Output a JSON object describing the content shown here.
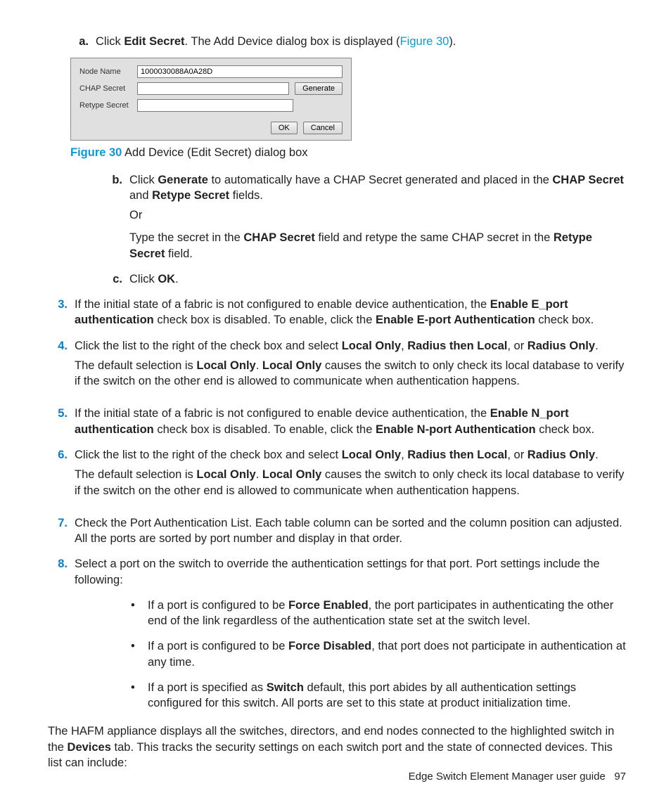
{
  "step_a": {
    "marker": "a.",
    "pre": "Click ",
    "bold": "Edit Secret",
    "post": ". The Add Device dialog box is displayed (",
    "link": "Figure 30",
    "tail": ")."
  },
  "dialog": {
    "label_node": "Node Name",
    "value_node": "1000030088A0A28D",
    "label_chap": "CHAP Secret",
    "label_retype": "Retype Secret",
    "btn_generate": "Generate",
    "btn_ok": "OK",
    "btn_cancel": "Cancel"
  },
  "figcap": {
    "label": "Figure 30",
    "text": " Add Device (Edit Secret) dialog box"
  },
  "step_b": {
    "marker": "b.",
    "t1": "Click ",
    "b1": "Generate",
    "t2": " to automatically have a CHAP Secret generated and placed in the ",
    "b2": "CHAP Secret",
    "t3": " and ",
    "b3": "Retype Secret",
    "t4": " fields.",
    "or": "Or",
    "t5": "Type the secret in the ",
    "b4": "CHAP Secret",
    "t6": " field and retype the same CHAP secret in the ",
    "b5": "Retype Secret",
    "t7": " field."
  },
  "step_c": {
    "marker": "c.",
    "t1": "Click ",
    "b1": "OK",
    "t2": "."
  },
  "step3": {
    "marker": "3.",
    "t1": "If the initial state of a fabric is not configured to enable device authentication, the ",
    "b1": "Enable E_port authentication",
    "t2": " check box is disabled. To enable, click the ",
    "b2": "Enable E-port Authentication",
    "t3": " check box."
  },
  "step4": {
    "marker": "4.",
    "t1": "Click the list to the right of the check box and select ",
    "b1": "Local Only",
    "t2": ", ",
    "b2": "Radius then Local",
    "t3": ", or ",
    "b3": "Radius Only",
    "t4": ".",
    "p_t1": "The default selection is ",
    "p_b1": "Local Only",
    "p_t2": ". ",
    "p_b2": "Local Only",
    "p_t3": " causes the switch to only check its local database to verify if the switch on the other end is allowed to communicate when authentication happens."
  },
  "step5": {
    "marker": "5.",
    "t1": "If the initial state of a fabric is not configured to enable device authentication, the ",
    "b1": "Enable N_port authentication",
    "t2": " check box is disabled. To enable, click the ",
    "b2": "Enable N-port Authentication",
    "t3": " check box."
  },
  "step6": {
    "marker": "6.",
    "t1": "Click the list to the right of the check box and select ",
    "b1": "Local Only",
    "t2": ", ",
    "b2": "Radius then Local",
    "t3": ", or ",
    "b3": "Radius Only",
    "t4": ".",
    "p_t1": "The default selection is ",
    "p_b1": "Local Only",
    "p_t2": ". ",
    "p_b2": "Local Only",
    "p_t3": " causes the switch to only check its local database to verify if the switch on the other end is allowed to communicate when authentication happens."
  },
  "step7": {
    "marker": "7.",
    "text": "Check the Port Authentication List. Each table column can be sorted and the column position can adjusted. All the ports are sorted by port number and display in that order."
  },
  "step8": {
    "marker": "8.",
    "text": "Select a port on the switch to override the authentication settings for that port. Port settings include the following:"
  },
  "bullets": {
    "dot": "•",
    "i1": {
      "t1": "If a port is configured to be ",
      "b1": "Force Enabled",
      "t2": ", the port participates in authenticating the other end of the link regardless of the authentication state set at the switch level."
    },
    "i2": {
      "t1": "If a port is configured to be ",
      "b1": "Force Disabled",
      "t2": ", that port does not participate in authentication at any time."
    },
    "i3": {
      "t1": "If a port is specified as ",
      "b1": "Switch",
      "t2": " default, this port abides by all authentication settings configured for this switch. All ports are set to this state at product initialization time."
    }
  },
  "closing": {
    "t1": "The HAFM appliance displays all the switches, directors, and end nodes connected to the highlighted switch in the ",
    "b1": "Devices",
    "t2": " tab. This tracks the security settings on each switch port and the state of connected devices. This list can include:"
  },
  "footer": {
    "title": "Edge Switch Element Manager user guide",
    "page": "97"
  }
}
